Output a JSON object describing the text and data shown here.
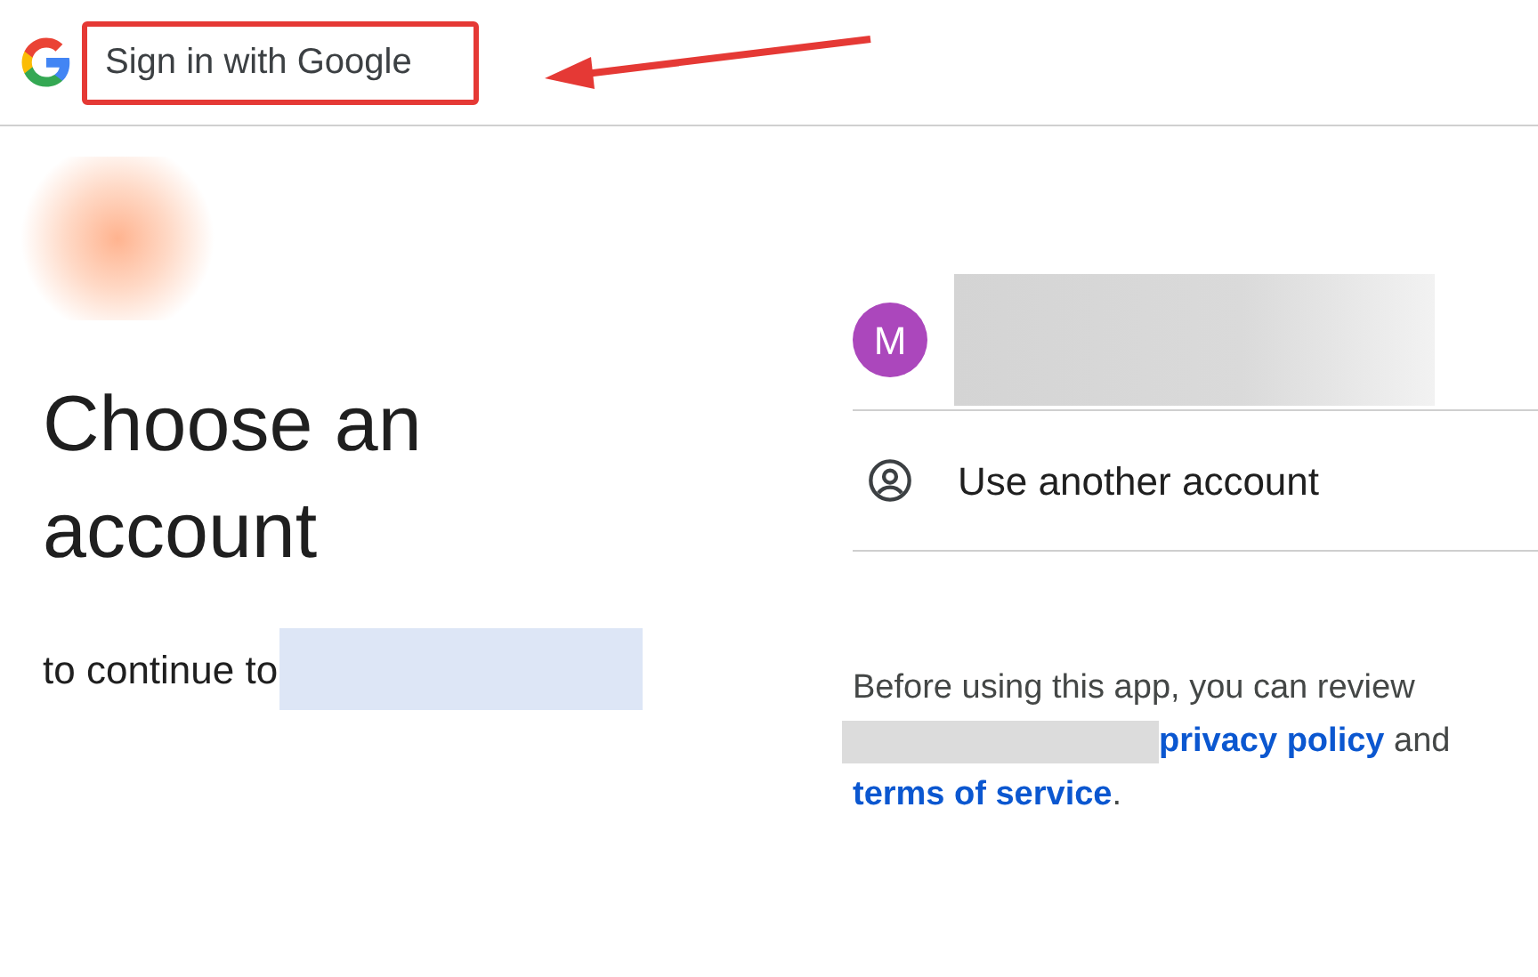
{
  "header": {
    "title": "Sign in with Google"
  },
  "annotations": {
    "highlight_box": true,
    "arrow": true
  },
  "heading": "Choose an account",
  "subtitle": "to continue to",
  "accounts": [
    {
      "avatar_letter": "M",
      "color": "#ab47bc"
    }
  ],
  "other_account": {
    "label": "Use another account"
  },
  "consent": {
    "prefix": "Before using this app, you can review",
    "privacy_link": "privacy policy",
    "middle": "and",
    "terms_link": "terms of service",
    "suffix": "."
  }
}
